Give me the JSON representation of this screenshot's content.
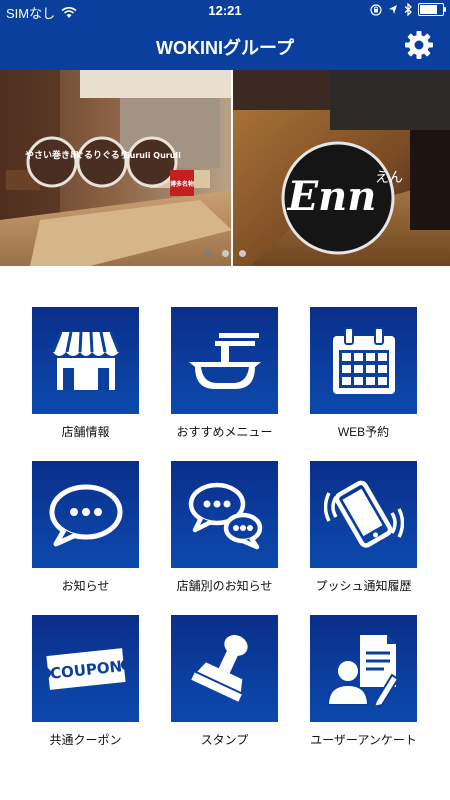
{
  "status_bar": {
    "carrier": "SIMなし",
    "time": "12:21",
    "battery_level": 0.85
  },
  "header": {
    "title": "WOKINIグループ",
    "settings_icon": "gear-icon"
  },
  "banner": {
    "left_logos": [
      "やさい巻き串",
      "ぐるりぐるり",
      "Guruli Quruli",
      "博多名物"
    ],
    "right_logo": "Enn",
    "right_logo_sub": "えん",
    "slide_count": 3,
    "active_slide": 0
  },
  "menu": {
    "items": [
      {
        "label": "店舗情報",
        "icon": "shop-icon"
      },
      {
        "label": "おすすめメニュー",
        "icon": "bowl-icon"
      },
      {
        "label": "WEB予約",
        "icon": "calendar-icon"
      },
      {
        "label": "お知らせ",
        "icon": "speech-bubble-icon"
      },
      {
        "label": "店舗別のお知らせ",
        "icon": "chat-bubbles-icon"
      },
      {
        "label": "プッシュ通知履歴",
        "icon": "vibrating-phone-icon"
      },
      {
        "label": "共通クーポン",
        "icon": "coupon-icon",
        "icon_text": "COUPON"
      },
      {
        "label": "スタンプ",
        "icon": "stamp-icon"
      },
      {
        "label": "ユーザーアンケート",
        "icon": "survey-icon"
      }
    ]
  },
  "colors": {
    "brand": "#0b3f9e",
    "tile_top": "#0a2e89",
    "tile_bottom": "#0c49ad"
  }
}
